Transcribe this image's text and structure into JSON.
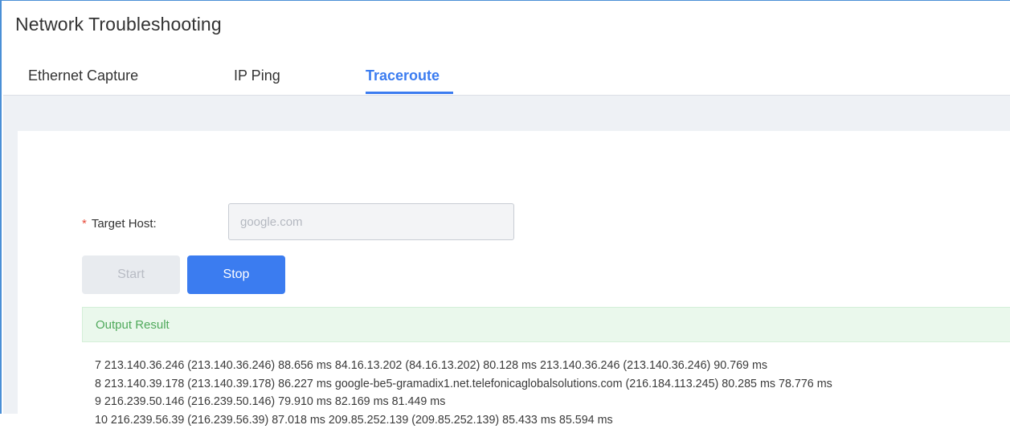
{
  "page": {
    "title": "Network Troubleshooting"
  },
  "tabs": [
    {
      "label": "Ethernet Capture",
      "active": false
    },
    {
      "label": "IP Ping",
      "active": false
    },
    {
      "label": "Traceroute",
      "active": true
    }
  ],
  "form": {
    "target_host_label": "Target Host:",
    "required_marker": "*",
    "target_host_placeholder": "google.com",
    "target_host_value": ""
  },
  "buttons": {
    "start_label": "Start",
    "start_enabled": false,
    "stop_label": "Stop",
    "stop_enabled": true
  },
  "output": {
    "title": "Output Result",
    "lines": [
      "7 213.140.36.246 (213.140.36.246) 88.656 ms 84.16.13.202 (84.16.13.202) 80.128 ms 213.140.36.246 (213.140.36.246) 90.769 ms",
      "8 213.140.39.178 (213.140.39.178) 86.227 ms google-be5-gramadix1.net.telefonicaglobalsolutions.com (216.184.113.245) 80.285 ms 78.776 ms",
      "9 216.239.50.146 (216.239.50.146) 79.910 ms 82.169 ms 81.449 ms",
      "10 216.239.56.39 (216.239.56.39) 87.018 ms 209.85.252.139 (209.85.252.139) 85.433 ms 85.594 ms"
    ]
  },
  "colors": {
    "accent": "#3b7cf0",
    "required": "#e74c3c",
    "success_text": "#4fa95b",
    "success_bg": "#eaf8ec",
    "page_bg": "#eef1f5"
  }
}
